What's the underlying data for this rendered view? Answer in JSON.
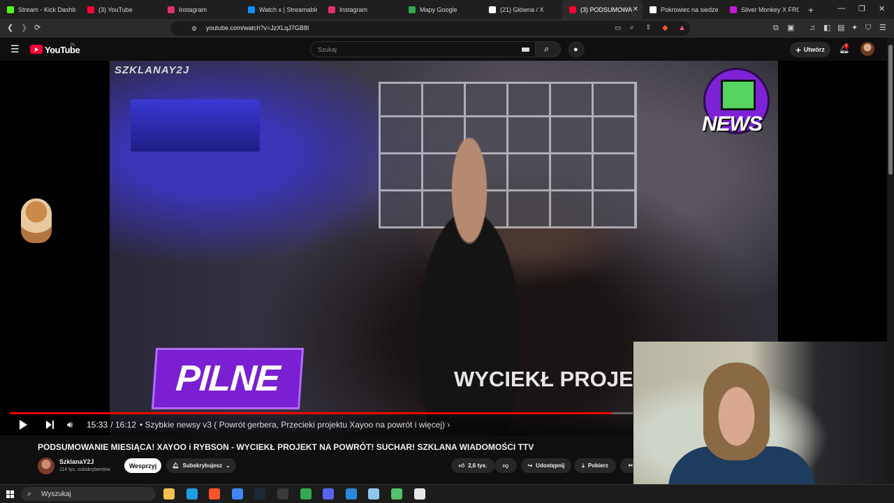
{
  "browser": {
    "tabs": [
      {
        "title": "Stream - Kick Dashb",
        "favicon": "kick-icon",
        "color": "#53fc18"
      },
      {
        "title": "(3) YouTube",
        "favicon": "youtube-icon",
        "color": "#ff0033"
      },
      {
        "title": "Instagram",
        "favicon": "instagram-icon",
        "color": "#e1306c"
      },
      {
        "title": "Watch x | Streamable",
        "favicon": "streamable-icon",
        "color": "#0f90fa"
      },
      {
        "title": "Instagram",
        "favicon": "instagram-icon",
        "color": "#e1306c"
      },
      {
        "title": "Mapy Google",
        "favicon": "maps-icon",
        "color": "#34a853"
      },
      {
        "title": "(21) Główna / X",
        "favicon": "x-icon",
        "color": "#ffffff"
      },
      {
        "title": "(3) PODSUMOWA",
        "favicon": "youtube-icon",
        "color": "#ff0033",
        "active": true
      },
      {
        "title": "Pokrowiec na siedzenie",
        "favicon": "store-icon",
        "color": "#ffffff"
      },
      {
        "title": "Silver Monkey X FROST",
        "favicon": "store-icon",
        "color": "#c51bd6"
      }
    ],
    "new_tab": "+",
    "window_controls": {
      "minimize": "—",
      "restore": "❐",
      "close": "✕"
    },
    "url": "youtube.com/watch?v=JzXLqJ7GB8I",
    "notifications_count": "3"
  },
  "youtube": {
    "logo_text": "YouTube",
    "country_code": "PL",
    "search_placeholder": "Szukaj",
    "create_label": "Utwórz"
  },
  "video": {
    "watermark": "SZKLANAY2J",
    "banner_left": "PILNE",
    "banner_right": "WYCIEKŁ PROJEKT X",
    "news_logo_text": "NEWS",
    "progress": 0.9659,
    "time_current": "15:33",
    "time_separator": " / ",
    "time_total": "16:12",
    "chapter": "• Szybkie newsy v3 ( Powrót gerbera, Przecieki projektu Xayoo na powrót i więcej) ›",
    "title": "PODSUMOWANIE MIESIĄCA! XAYOO i RYBSON - WYCIEKŁ PROJEKT NA POWRÓT! SUCHAR! SZKLANA WIADOMOŚCI TTV"
  },
  "channel": {
    "name": "SzklanaY2J",
    "subscribers": "114 tys. subskrybentów",
    "support_label": "Wesprzyj",
    "subscribed_label": "Subskrybujesz"
  },
  "actions": {
    "likes": "2,6 tys.",
    "share": "Udostępnij",
    "download": "Pobierz"
  },
  "taskbar": {
    "search_placeholder": "Wyszukaj",
    "apps": [
      {
        "name": "file-explorer-icon",
        "color": "#f2c14e"
      },
      {
        "name": "edge-icon",
        "color": "#1f9de0"
      },
      {
        "name": "brave-icon",
        "color": "#fb542b"
      },
      {
        "name": "chrome-icon",
        "color": "#4285f4"
      },
      {
        "name": "steam-icon",
        "color": "#1b2838"
      },
      {
        "name": "obs-icon",
        "color": "#3a3a3a"
      },
      {
        "name": "play-store-icon",
        "color": "#34a853"
      },
      {
        "name": "discord-icon",
        "color": "#5865f2"
      },
      {
        "name": "app-icon",
        "color": "#2b88d8"
      },
      {
        "name": "notepad-icon",
        "color": "#8fc7e8"
      },
      {
        "name": "app-icon-green",
        "color": "#53c26b"
      },
      {
        "name": "window-icon",
        "color": "#e6e6e6"
      }
    ]
  }
}
